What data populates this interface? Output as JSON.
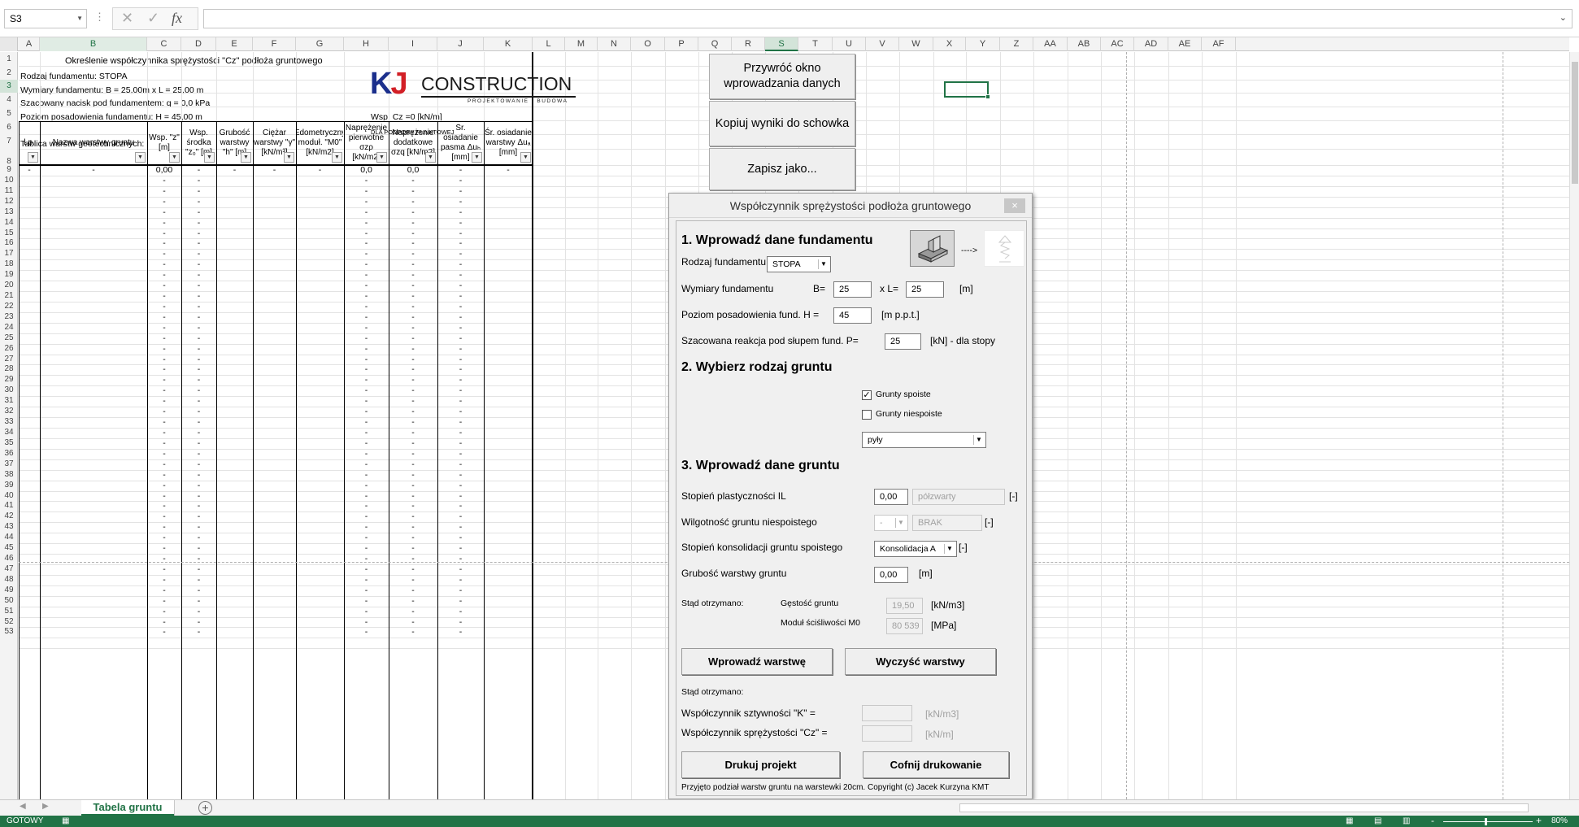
{
  "formula_bar": {
    "name_box": "S3",
    "cancel_icon": "✕",
    "enter_icon": "✓",
    "fx_label": "fx",
    "formula": ""
  },
  "columns": [
    "A",
    "B",
    "C",
    "D",
    "E",
    "F",
    "G",
    "H",
    "I",
    "J",
    "K",
    "L",
    "M",
    "N",
    "O",
    "P",
    "Q",
    "R",
    "S",
    "T",
    "U",
    "V",
    "W",
    "X",
    "Y",
    "Z",
    "AA",
    "AB",
    "AC",
    "AD",
    "AE",
    "AF"
  ],
  "sheet": {
    "title": "Określenie współczynnika sprężystości \"Cz\" podłoża gruntowego",
    "line2": "Rodzaj fundamentu: STOPA",
    "line3": "Wymiary fundamentu:  B =  25,00m  x  L =  25,00 m",
    "line4": "Szacowany nacisk pod fundamentem:  q = 0,0 kPa",
    "line5": "Poziom posadowienia fundamentu:  H = 45,00 m",
    "line7": "Tablica warstw geotechnicznych:",
    "wsp_cz": "Wsp. Cz =0 [kN/m]",
    "podpora": "DLA PODPORY PUNKTOWEJ",
    "logo_kj": "KJ",
    "logo_construction": "CONSTRUCTION",
    "logo_sub": "PROJEKTOWANIE I BUDOWA",
    "headers": {
      "A": "l.p.",
      "B": "Nazwa warstwy gruntu",
      "C": "Wsp. \"z\" [m]",
      "D": "Wsp. środka \"z₀\" [m]",
      "E": "Grubość warstwy \"h\" [m]",
      "F": "Ciężar warstwy \"γ\" [kN/m³]",
      "G": "Edometryczny moduł. \"M0\" [kN/m2]",
      "H": "Naprężenie pierwotne σzρ [kN/m2]",
      "I": "Naprężenie dodatkowe σzq [kN/m2]",
      "J": "Śr. osiadanie pasma Δuₕ [mm]",
      "K": "Śr. osiadanie warstwy Δuₐ [mm]"
    },
    "row9": {
      "A": "-",
      "B": "-",
      "C": "0,00",
      "D": "-",
      "E": "-",
      "F": "-",
      "G": "-",
      "H": "0,0",
      "I": "0,0",
      "J": "-",
      "K": "-"
    },
    "dash": "-"
  },
  "buttons": {
    "restore": "Przywróć okno wprowadzania danych",
    "copy": "Kopiuj wyniki do schowka",
    "save_as": "Zapisz jako..."
  },
  "dialog": {
    "title": "Współczynnik sprężystości podłoża gruntowego",
    "close": "×",
    "section1": "1. Wprowadź dane fundamentu",
    "rodzaj_label": "Rodzaj fundamentu",
    "rodzaj_value": "STOPA",
    "wymiary_label": "Wymiary fundamentu",
    "b_label": "B=",
    "b_value": "25",
    "l_label": "x L=",
    "l_value": "25",
    "wymiary_unit": "[m]",
    "poziom_label": "Poziom posadowienia fund. H =",
    "poziom_value": "45",
    "poziom_unit": "[m p.p.t.]",
    "reakcja_label": "Szacowana reakcja pod słupem fund.  P=",
    "reakcja_value": "25",
    "reakcja_unit": "[kN] - dla stopy",
    "arrow": "---->",
    "section2": "2. Wybierz rodzaj gruntu",
    "spoiste_label": "Grunty spoiste",
    "spoiste_checked": true,
    "niespoiste_label": "Grunty niespoiste",
    "niespoiste_checked": false,
    "grunt_value": "pyły",
    "section3": "3. Wprowadź dane gruntu",
    "il_label": "Stopień plastyczności  IL",
    "il_value": "0,00",
    "il_desc": "półzwarty",
    "il_unit": "[-]",
    "wilg_label": "Wilgotność gruntu niespoistego",
    "wilg_value": "-",
    "wilg_desc": "BRAK",
    "wilg_unit": "[-]",
    "kons_label": "Stopień konsolidacji gruntu spoistego",
    "kons_value": "Konsolidacja A",
    "kons_unit": "[-]",
    "grub_label": "Grubość warstwy gruntu",
    "grub_value": "0,00",
    "grub_unit": "[m]",
    "stad1": "Stąd otrzymano:",
    "gestosc_label": "Gęstość gruntu",
    "gestosc_value": "19,50",
    "gestosc_unit": "[kN/m3]",
    "modul_label": "Moduł ściśliwości M0",
    "modul_value": "80 539",
    "modul_unit": "[MPa]",
    "btn_wprowadz": "Wprowadź warstwę",
    "btn_wyczysc": "Wyczyść warstwy",
    "stad2": "Stąd otrzymano:",
    "k_label": "Współczynnik sztywności \"K\" =",
    "k_value": "",
    "k_unit": "[kN/m3]",
    "cz_label": "Współczynnik sprężystości \"Cz\" =",
    "cz_value": "",
    "cz_unit": "[kN/m]",
    "btn_drukuj": "Drukuj projekt",
    "btn_cofnij": "Cofnij drukowanie",
    "footer": "Przyjęto podział warstw gruntu na warstewki 20cm. Copyright (c) Jacek Kurzyna KMT"
  },
  "sheet_tabs": {
    "active": "Tabela gruntu",
    "add": "+"
  },
  "status": {
    "ready": "GOTOWY",
    "zoom": "80%",
    "zoom_minus": "-",
    "zoom_plus": "+"
  }
}
